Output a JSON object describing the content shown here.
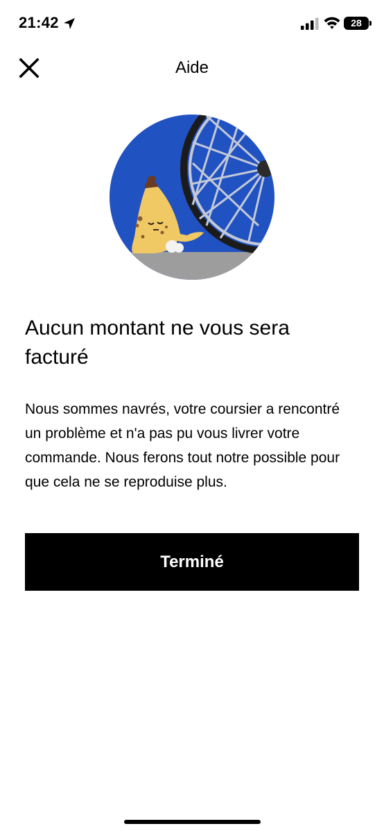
{
  "status_bar": {
    "time": "21:42",
    "battery": "28"
  },
  "header": {
    "title": "Aide"
  },
  "main": {
    "heading": "Aucun montant ne vous sera facturé",
    "message": "Nous sommes navrés, votre coursier a rencontré un problème et n'a pas pu vous livrer votre commande.  Nous ferons tout notre possible pour que cela ne se reproduise plus.",
    "done_label": "Terminé"
  },
  "icons": {
    "close": "close-icon",
    "location": "location-arrow-icon",
    "signal": "cellular-signal-icon",
    "wifi": "wifi-icon",
    "battery": "battery-icon"
  },
  "colors": {
    "illustration_background": "#2152c1",
    "button_background": "#000000",
    "button_text": "#ffffff"
  }
}
